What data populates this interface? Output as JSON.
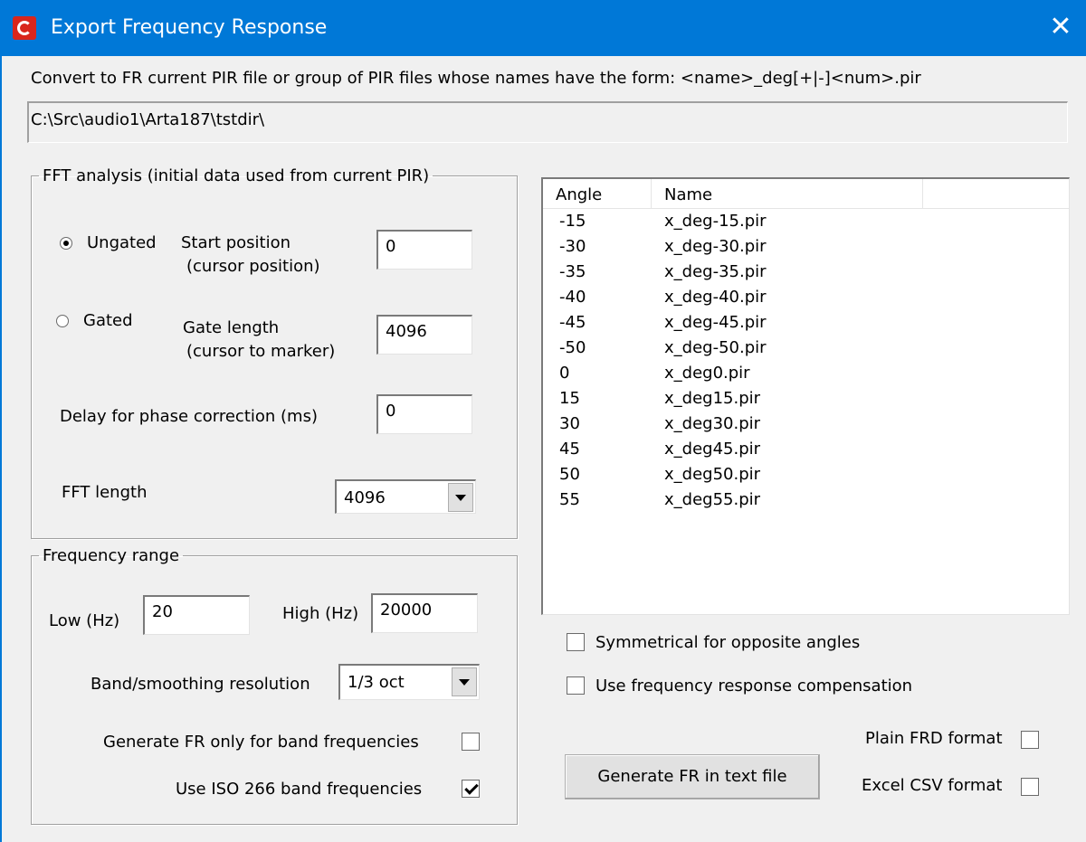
{
  "window": {
    "title": "Export Frequency Response",
    "close_glyph": "✕"
  },
  "description": "Convert to FR current  PIR file or group of  PIR files whose names have the form: <name>_deg[+|-]<num>.pir",
  "path": "C:\\Src\\audio1\\Arta187\\tstdir\\",
  "fft_group": {
    "legend": "FFT analysis (initial data used from current PIR)",
    "ungated_label": "Ungated",
    "ungated_selected": true,
    "start_position_label": "Start position",
    "start_position_sub": "(cursor position)",
    "start_position_value": "0",
    "gated_label": "Gated",
    "gated_selected": false,
    "gate_length_label": "Gate length",
    "gate_length_sub": "(cursor to marker)",
    "gate_length_value": "4096",
    "delay_label": "Delay for phase correction (ms)",
    "delay_value": "0",
    "fft_length_label": "FFT length",
    "fft_length_value": "4096"
  },
  "freq_group": {
    "legend": "Frequency range",
    "low_label": "Low (Hz)",
    "low_value": "20",
    "high_label": "High (Hz)",
    "high_value": "20000",
    "resolution_label": "Band/smoothing resolution",
    "resolution_value": "1/3 oct",
    "band_only_label": "Generate FR only for band frequencies",
    "band_only_checked": false,
    "iso_label": "Use ISO 266 band frequencies",
    "iso_checked": true
  },
  "file_list": {
    "columns": [
      "Angle",
      "Name"
    ],
    "rows": [
      {
        "angle": "-15",
        "name": "x_deg-15.pir"
      },
      {
        "angle": "-30",
        "name": "x_deg-30.pir"
      },
      {
        "angle": "-35",
        "name": "x_deg-35.pir"
      },
      {
        "angle": "-40",
        "name": "x_deg-40.pir"
      },
      {
        "angle": "-45",
        "name": "x_deg-45.pir"
      },
      {
        "angle": "-50",
        "name": "x_deg-50.pir"
      },
      {
        "angle": "0",
        "name": "x_deg0.pir"
      },
      {
        "angle": "15",
        "name": "x_deg15.pir"
      },
      {
        "angle": "30",
        "name": "x_deg30.pir"
      },
      {
        "angle": "45",
        "name": "x_deg45.pir"
      },
      {
        "angle": "50",
        "name": "x_deg50.pir"
      },
      {
        "angle": "55",
        "name": "x_deg55.pir"
      }
    ]
  },
  "options": {
    "symmetrical_label": "Symmetrical for opposite angles",
    "symmetrical_checked": false,
    "compensation_label": "Use frequency response compensation",
    "compensation_checked": false,
    "plain_frd_label": "Plain FRD format",
    "plain_frd_checked": false,
    "excel_csv_label": "Excel CSV format",
    "excel_csv_checked": false
  },
  "generate_button": "Generate FR in text file",
  "colors": {
    "titlebar": "#0078d7",
    "dialog_bg": "#f0f0f0",
    "icon_red": "#d9261c"
  }
}
